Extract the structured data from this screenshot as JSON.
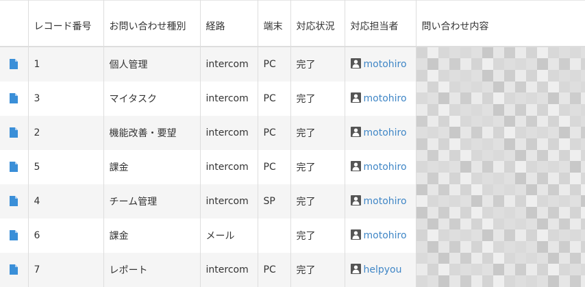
{
  "columns": [
    "",
    "レコード番号",
    "お問い合わせ種別",
    "経路",
    "端末",
    "対応状況",
    "対応担当者",
    "問い合わせ内容"
  ],
  "rows": [
    {
      "record_no": "1",
      "type": "個人管理",
      "route": "intercom",
      "device": "PC",
      "status": "完了",
      "assignee": "motohiro"
    },
    {
      "record_no": "3",
      "type": "マイタスク",
      "route": "intercom",
      "device": "PC",
      "status": "完了",
      "assignee": "motohiro"
    },
    {
      "record_no": "2",
      "type": "機能改善・要望",
      "route": "intercom",
      "device": "PC",
      "status": "完了",
      "assignee": "motohiro"
    },
    {
      "record_no": "5",
      "type": "課金",
      "route": "intercom",
      "device": "PC",
      "status": "完了",
      "assignee": "motohiro"
    },
    {
      "record_no": "4",
      "type": "チーム管理",
      "route": "intercom",
      "device": "SP",
      "status": "完了",
      "assignee": "motohiro"
    },
    {
      "record_no": "6",
      "type": "課金",
      "route": "メール",
      "device": "",
      "status": "完了",
      "assignee": "motohiro"
    },
    {
      "record_no": "7",
      "type": "レポート",
      "route": "intercom",
      "device": "PC",
      "status": "完了",
      "assignee": "helpyou"
    }
  ],
  "colors": {
    "link": "#3f86c6",
    "icon": "#3a8fd8",
    "row_alt": "#f5f5f5",
    "border": "#dddddd",
    "avatar_bg": "#555555"
  },
  "icons": {
    "record": "document-icon",
    "assignee": "person-icon"
  }
}
